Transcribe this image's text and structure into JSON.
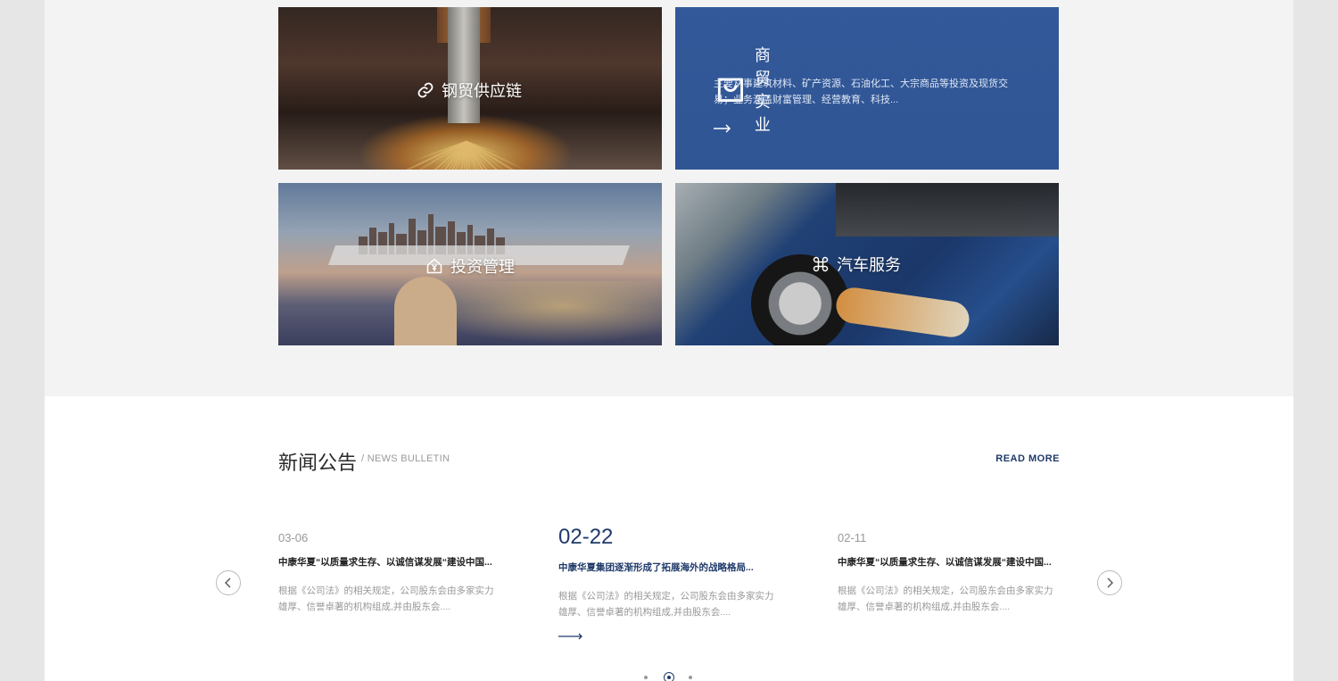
{
  "services": [
    {
      "title": "钢贸供应链",
      "icon": "link-icon"
    },
    {
      "title": "商贸实业",
      "icon": "shopping-bag-icon",
      "desc": "主要从事建筑材料、矿产资源、石油化工、大宗商品等投资及现货交易；业务涵盖财富管理、经营教育、科技..."
    },
    {
      "title": "投资管理",
      "icon": "house-yen-icon"
    },
    {
      "title": "汽车服务",
      "icon": "command-icon"
    }
  ],
  "news": {
    "title": "新闻公告",
    "subtitle": "/ NEWS BULLETIN",
    "read_more": "READ MORE",
    "items": [
      {
        "date": "03-06",
        "headline": "中康华夏“以质量求生存、以诚信谋发展“建设中国...",
        "excerpt": "根据《公司法》的相关规定，公司股东会由多家实力雄厚、信誉卓著的机构组成,并由股东会...."
      },
      {
        "date": "02-22",
        "headline": "中康华夏集团逐渐形成了拓展海外的战略格局...",
        "excerpt": "根据《公司法》的相关规定，公司股东会由多家实力雄厚、信誉卓著的机构组成,并由股东会...."
      },
      {
        "date": "02-11",
        "headline": "中康华夏“以质量求生存、以诚信谋发展“建设中国...",
        "excerpt": "根据《公司法》的相关规定，公司股东会由多家实力雄厚、信誉卓著的机构组成,并由股东会...."
      }
    ],
    "active_index": 1,
    "pagination": {
      "count": 3,
      "active": 1
    }
  },
  "colors": {
    "accent": "#1f3a6a",
    "trade_bg": "#2f5594",
    "section_bg": "#f3f3f3",
    "outer_bg": "#e6e6e6"
  }
}
